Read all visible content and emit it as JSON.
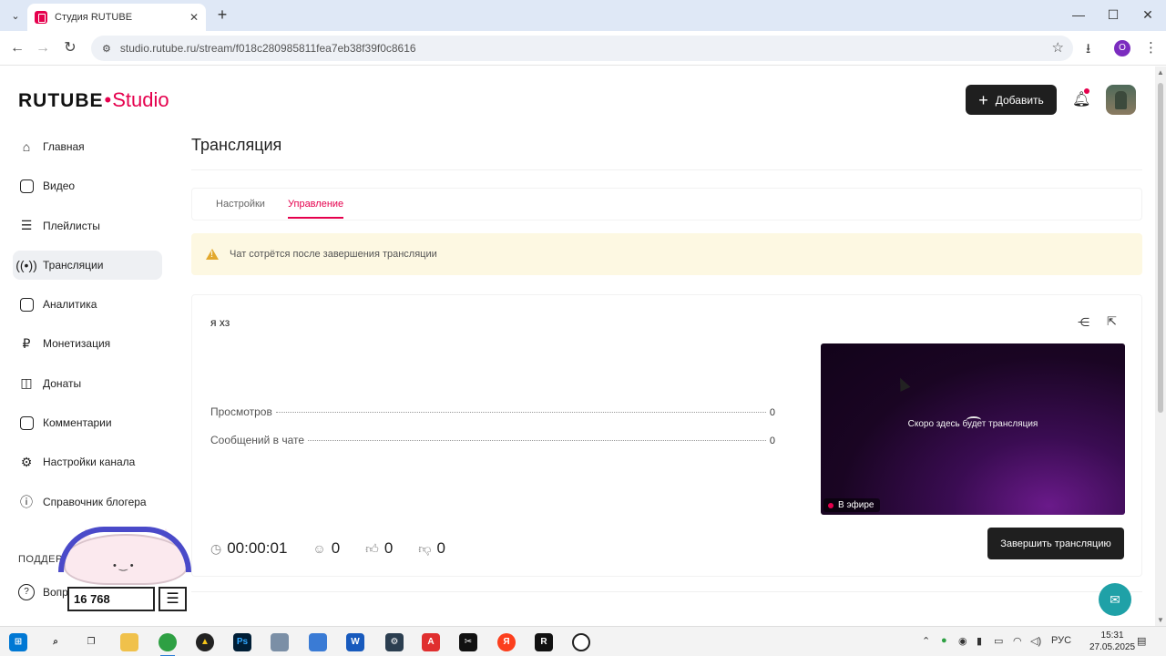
{
  "browser": {
    "tab_title": "Студия RUTUBE",
    "tab_close": "✕",
    "new_tab": "+",
    "url": "studio.rutube.ru/stream/f018c280985811fea7eb38f39f0c8616",
    "profile_initial": "O",
    "window_controls": [
      "—",
      "☐",
      "✕"
    ]
  },
  "header": {
    "logo_brand": "RUTUBE",
    "logo_studio": "Studio",
    "add_label": "Добавить"
  },
  "sidebar": {
    "items": [
      {
        "label": "Главная",
        "icon": "home-icon"
      },
      {
        "label": "Видео",
        "icon": "video-icon"
      },
      {
        "label": "Плейлисты",
        "icon": "playlist-icon"
      },
      {
        "label": "Трансляции",
        "icon": "broadcast-icon",
        "active": true
      },
      {
        "label": "Аналитика",
        "icon": "analytics-icon"
      },
      {
        "label": "Монетизация",
        "icon": "ruble-icon"
      },
      {
        "label": "Донаты",
        "icon": "donate-icon"
      },
      {
        "label": "Комментарии",
        "icon": "comment-icon"
      },
      {
        "label": "Настройки канала",
        "icon": "gear-icon"
      },
      {
        "label": "Справочник блогера",
        "icon": "help-circle-icon"
      }
    ],
    "support_label": "ПОДДЕРЖКА",
    "faq_label": "Вопросы"
  },
  "main": {
    "title": "Трансляция",
    "tabs": [
      {
        "label": "Настройки",
        "active": false
      },
      {
        "label": "Управление",
        "active": true
      }
    ],
    "warning": "Чат сотрётся после завершения трансляции",
    "stream": {
      "name": "я хз",
      "stats": [
        {
          "label": "Просмотров",
          "value": "0"
        },
        {
          "label": "Сообщений в чате",
          "value": "0"
        }
      ],
      "preview_text": "Скоро здесь будет трансляция",
      "live_label": "В эфире",
      "duration": "00:00:01",
      "viewers": "0",
      "likes": "0",
      "dislikes": "0",
      "end_button": "Завершить трансляцию"
    }
  },
  "overlay": {
    "counter": "16 768",
    "cat_face": "• ‿ •"
  },
  "taskbar": {
    "language": "РУС",
    "time": "15:31",
    "date": "27.05.2025"
  },
  "colors": {
    "accent": "#e5004d",
    "dark_button": "#1f1f1f",
    "warning_bg": "#fdf8e2",
    "chat_fab": "#1fa1a7"
  }
}
